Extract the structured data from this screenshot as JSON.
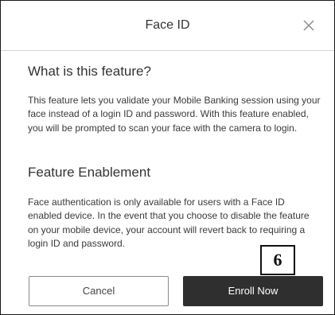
{
  "dialog": {
    "title": "Face ID",
    "close_icon": "close-icon"
  },
  "sections": [
    {
      "heading": "What is this feature?",
      "body": "This feature lets you validate your Mobile Banking session using your face instead of a login ID and password. With this feature enabled, you will be prompted to scan your face with the camera to login."
    },
    {
      "heading": "Feature Enablement",
      "body": "Face authentication is only available for users with a Face ID enabled device. In the event that you choose to disable the feature on your mobile device, your account will revert back to requiring a login ID and password."
    }
  ],
  "buttons": {
    "cancel_label": "Cancel",
    "enroll_label": "Enroll Now"
  },
  "callout": {
    "label": "6"
  }
}
